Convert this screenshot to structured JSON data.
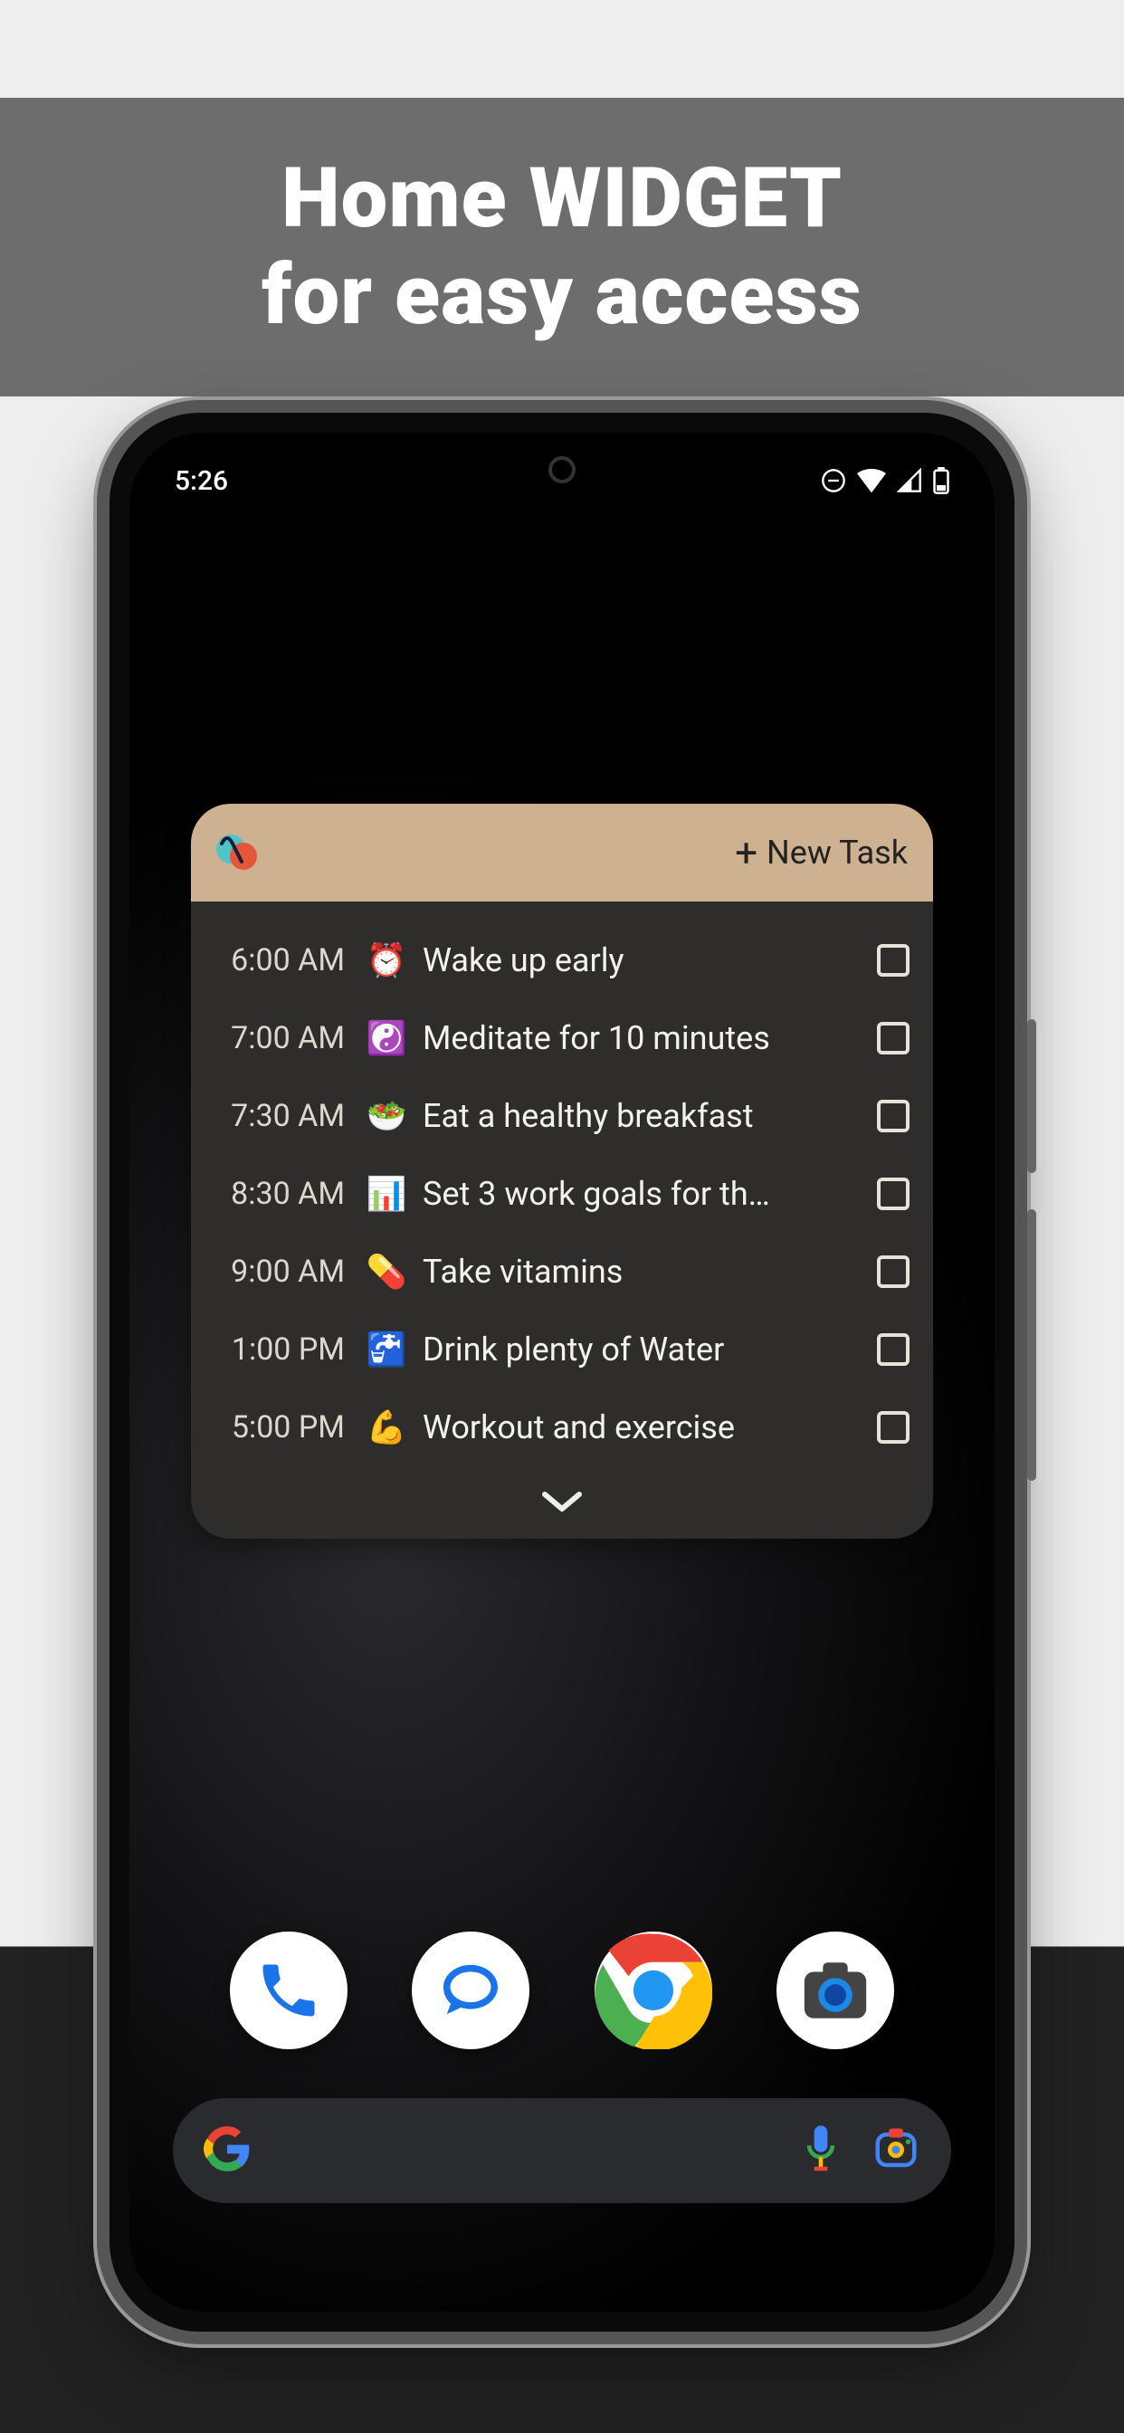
{
  "promo": {
    "line1": "Home WIDGET",
    "line2": "for easy access"
  },
  "status": {
    "time": "5:26"
  },
  "widget": {
    "new_task_label": "New Task",
    "tasks": [
      {
        "time": "6:00 AM",
        "emoji": "⏰",
        "title": "Wake up early"
      },
      {
        "time": "7:00 AM",
        "emoji": "☯️",
        "title": "Meditate for 10 minutes"
      },
      {
        "time": "7:30 AM",
        "emoji": "🥗",
        "title": "Eat a healthy breakfast"
      },
      {
        "time": "8:30 AM",
        "emoji": "📊",
        "title": "Set 3 work goals for th…"
      },
      {
        "time": "9:00 AM",
        "emoji": "💊",
        "title": "Take vitamins"
      },
      {
        "time": "1:00 PM",
        "emoji": "🚰",
        "title": "Drink plenty of Water"
      },
      {
        "time": "5:00 PM",
        "emoji": "💪",
        "title": "Workout and exercise"
      }
    ]
  },
  "dock": {
    "apps": [
      "phone",
      "messages",
      "chrome",
      "camera"
    ]
  }
}
